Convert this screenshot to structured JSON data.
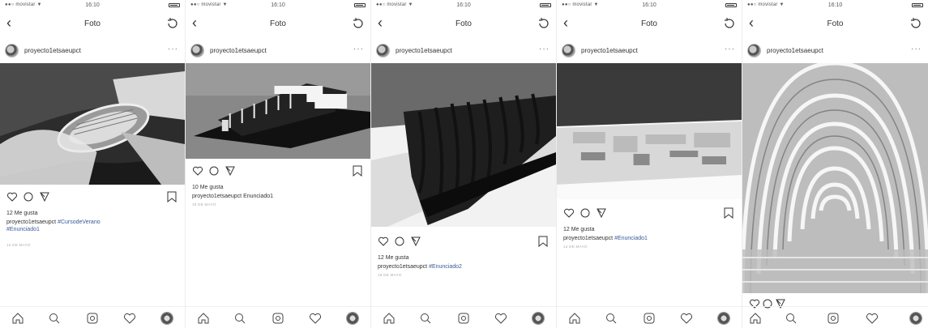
{
  "status_bar": {
    "carrier": "●●○ movistar ▼",
    "time": "16:10"
  },
  "nav": {
    "title": "Foto",
    "back_glyph": "‹"
  },
  "more_glyph": "···",
  "posts": [
    {
      "username": "proyecto1etsaeupct",
      "likes": "12 Me gusta",
      "caption_user": "proyecto1etsaeupct",
      "caption_tag": "#CursodeVerano",
      "caption_lines": [
        "#Enunciado1"
      ],
      "date": "12 DE MAYO"
    },
    {
      "username": "proyecto1etsaeupct",
      "likes": "10 Me gusta",
      "caption_user": "proyecto1etsaeupct",
      "caption_tag": "Enunciado1",
      "caption_lines": [],
      "date": "19 DE MAYO"
    },
    {
      "username": "proyecto1etsaeupct",
      "likes": "12 Me gusta",
      "caption_user": "proyecto1etsaeupct",
      "caption_tag": "#Enunciado2",
      "caption_lines": [],
      "date": "16 DE MAYO"
    },
    {
      "username": "proyecto1etsaeupct",
      "likes": "12 Me gusta",
      "caption_user": "proyecto1etsaeupct",
      "caption_tag": "#Enunciado1",
      "caption_lines": [],
      "date": "14 DE MAYO"
    },
    {
      "username": "proyecto1etsaeupct",
      "likes": "",
      "caption_user": "",
      "caption_tag": "",
      "caption_lines": [],
      "date": ""
    }
  ],
  "icons": {
    "back": "chevron-left-icon",
    "refresh": "refresh-icon",
    "like": "heart-icon",
    "comment": "comment-icon",
    "share": "send-icon",
    "save": "bookmark-icon",
    "home": "home-icon",
    "search": "search-icon",
    "camera": "camera-icon",
    "activity": "heart-icon",
    "profile": "avatar-icon"
  },
  "colors": {
    "hashtag": "#3a5a98",
    "text": "#222222",
    "muted": "#aaaaaa"
  }
}
